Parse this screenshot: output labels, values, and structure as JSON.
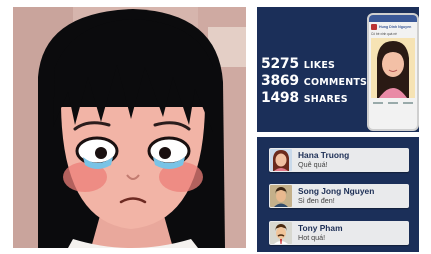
{
  "stats": [
    {
      "number": "5275",
      "label": "LIKES"
    },
    {
      "number": "3869",
      "label": "COMMENTS"
    },
    {
      "number": "1498",
      "label": "SHARES"
    }
  ],
  "phone": {
    "page_name": "Hung Dinh Nguyen",
    "caption": "Cô bé xinh quá nè"
  },
  "comments": [
    {
      "name": "Hana Truong",
      "message": "Quê quá!",
      "avatar": "woman-avatar-icon"
    },
    {
      "name": "Song Jong Nguyen",
      "message": "Sì đen đen!",
      "avatar": "man-avatar-icon"
    },
    {
      "name": "Tony Pham",
      "message": "Hot quá!",
      "avatar": "man-mustache-avatar-icon"
    }
  ],
  "colors": {
    "panel_bg": "#1b2f59",
    "comment_bg": "#e9eaec",
    "name_color": "#1d2f56"
  }
}
